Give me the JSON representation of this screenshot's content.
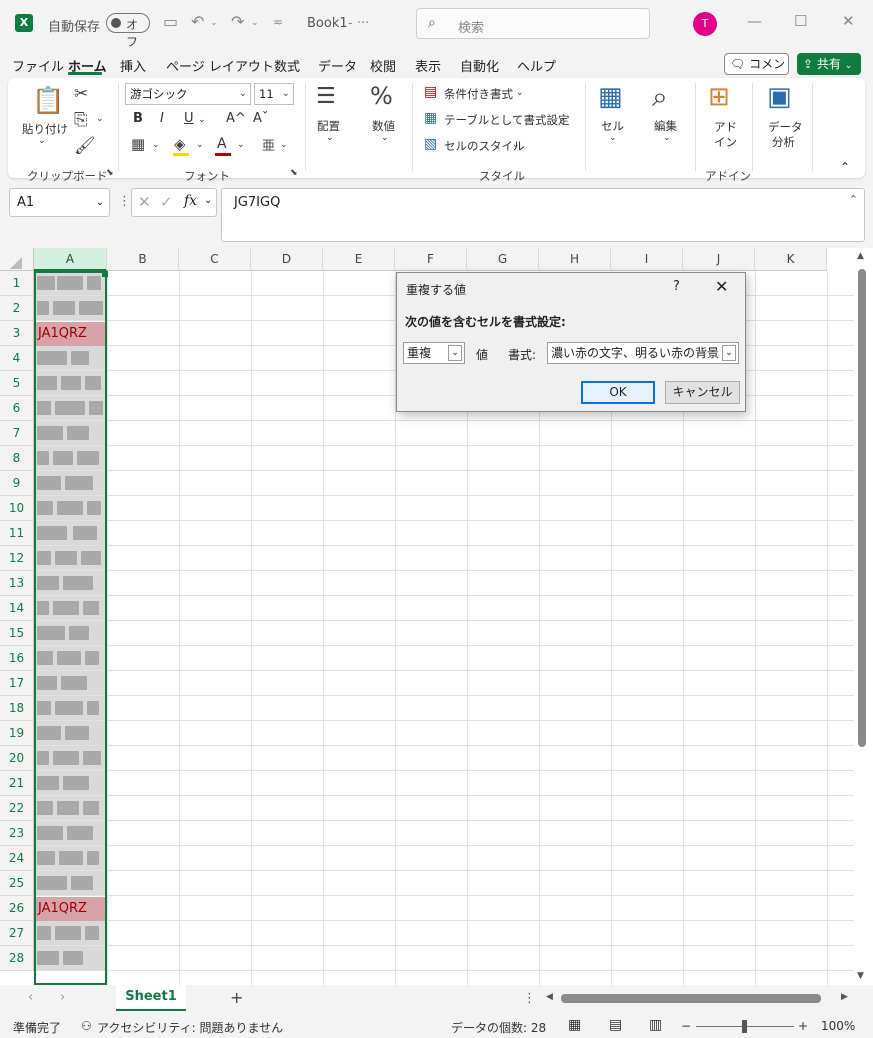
{
  "titlebar": {
    "autosave_label": "自動保存",
    "autosave_state": "オフ",
    "doc_title": "Book1",
    "doc_title_suffix": "- ···",
    "search_placeholder": "検索",
    "user_initial": "T"
  },
  "menu": {
    "items": [
      "ファイル",
      "ホーム",
      "挿入",
      "ページ レイアウト",
      "数式",
      "データ",
      "校閲",
      "表示",
      "自動化",
      "ヘルプ"
    ],
    "active": "ホーム",
    "comment_label": "コメント",
    "share_label": "共有"
  },
  "ribbon": {
    "paste_label": "貼り付け",
    "clipboard_group": "クリップボード",
    "font_name": "游ゴシック",
    "font_size": "11",
    "bold": "B",
    "italic": "I",
    "underline": "U",
    "grow_font": "A^",
    "shrink_font": "Aˇ",
    "font_color_glyph": "A",
    "font_group": "フォント",
    "alignment_label": "配置",
    "number_label": "数値",
    "conditional_format": "条件付き書式",
    "format_as_table": "テーブルとして書式設定",
    "cell_styles": "セルのスタイル",
    "styles_group": "スタイル",
    "cells_label": "セル",
    "editing_label": "編集",
    "addin_label_1": "アド",
    "addin_label_2": "イン",
    "addin_group": "アドイン",
    "analyze_label_1": "データ",
    "analyze_label_2": "分析",
    "colors": {
      "accent": "#107c41",
      "font_color": "#c00000",
      "highlight": "#ffd600"
    }
  },
  "formula_bar": {
    "name_box": "A1",
    "fx": "fx",
    "value": "JG7IGQ"
  },
  "grid": {
    "columns": [
      "A",
      "B",
      "C",
      "D",
      "E",
      "F",
      "G",
      "H",
      "I",
      "J",
      "K"
    ],
    "rows": [
      "1",
      "2",
      "3",
      "4",
      "5",
      "6",
      "7",
      "8",
      "9",
      "10",
      "11",
      "12",
      "13",
      "14",
      "15",
      "16",
      "17",
      "18",
      "19",
      "20",
      "21",
      "22",
      "23",
      "24",
      "25",
      "26",
      "27",
      "28"
    ],
    "duplicate_value_row3": "JA1QRZ",
    "duplicate_value_row26": "JA1QRZ",
    "duplicate_fill": "#d8a3a8",
    "duplicate_text_color": "#9c0006"
  },
  "dialog": {
    "title": "重複する値",
    "help": "?",
    "heading": "次の値を含むセルを書式設定:",
    "type_value": "重複",
    "value_label": "値",
    "format_label": "書式:",
    "format_value": "濃い赤の文字、明るい赤の背景",
    "ok_label": "OK",
    "cancel_label": "キャンセル"
  },
  "sheets": {
    "active": "Sheet1",
    "add": "+"
  },
  "status": {
    "ready": "準備完了",
    "accessibility": "アクセシビリティ: 問題ありません",
    "count_label": "データの個数: 28",
    "zoom": "100%",
    "zoom_minus": "−",
    "zoom_plus": "+"
  }
}
